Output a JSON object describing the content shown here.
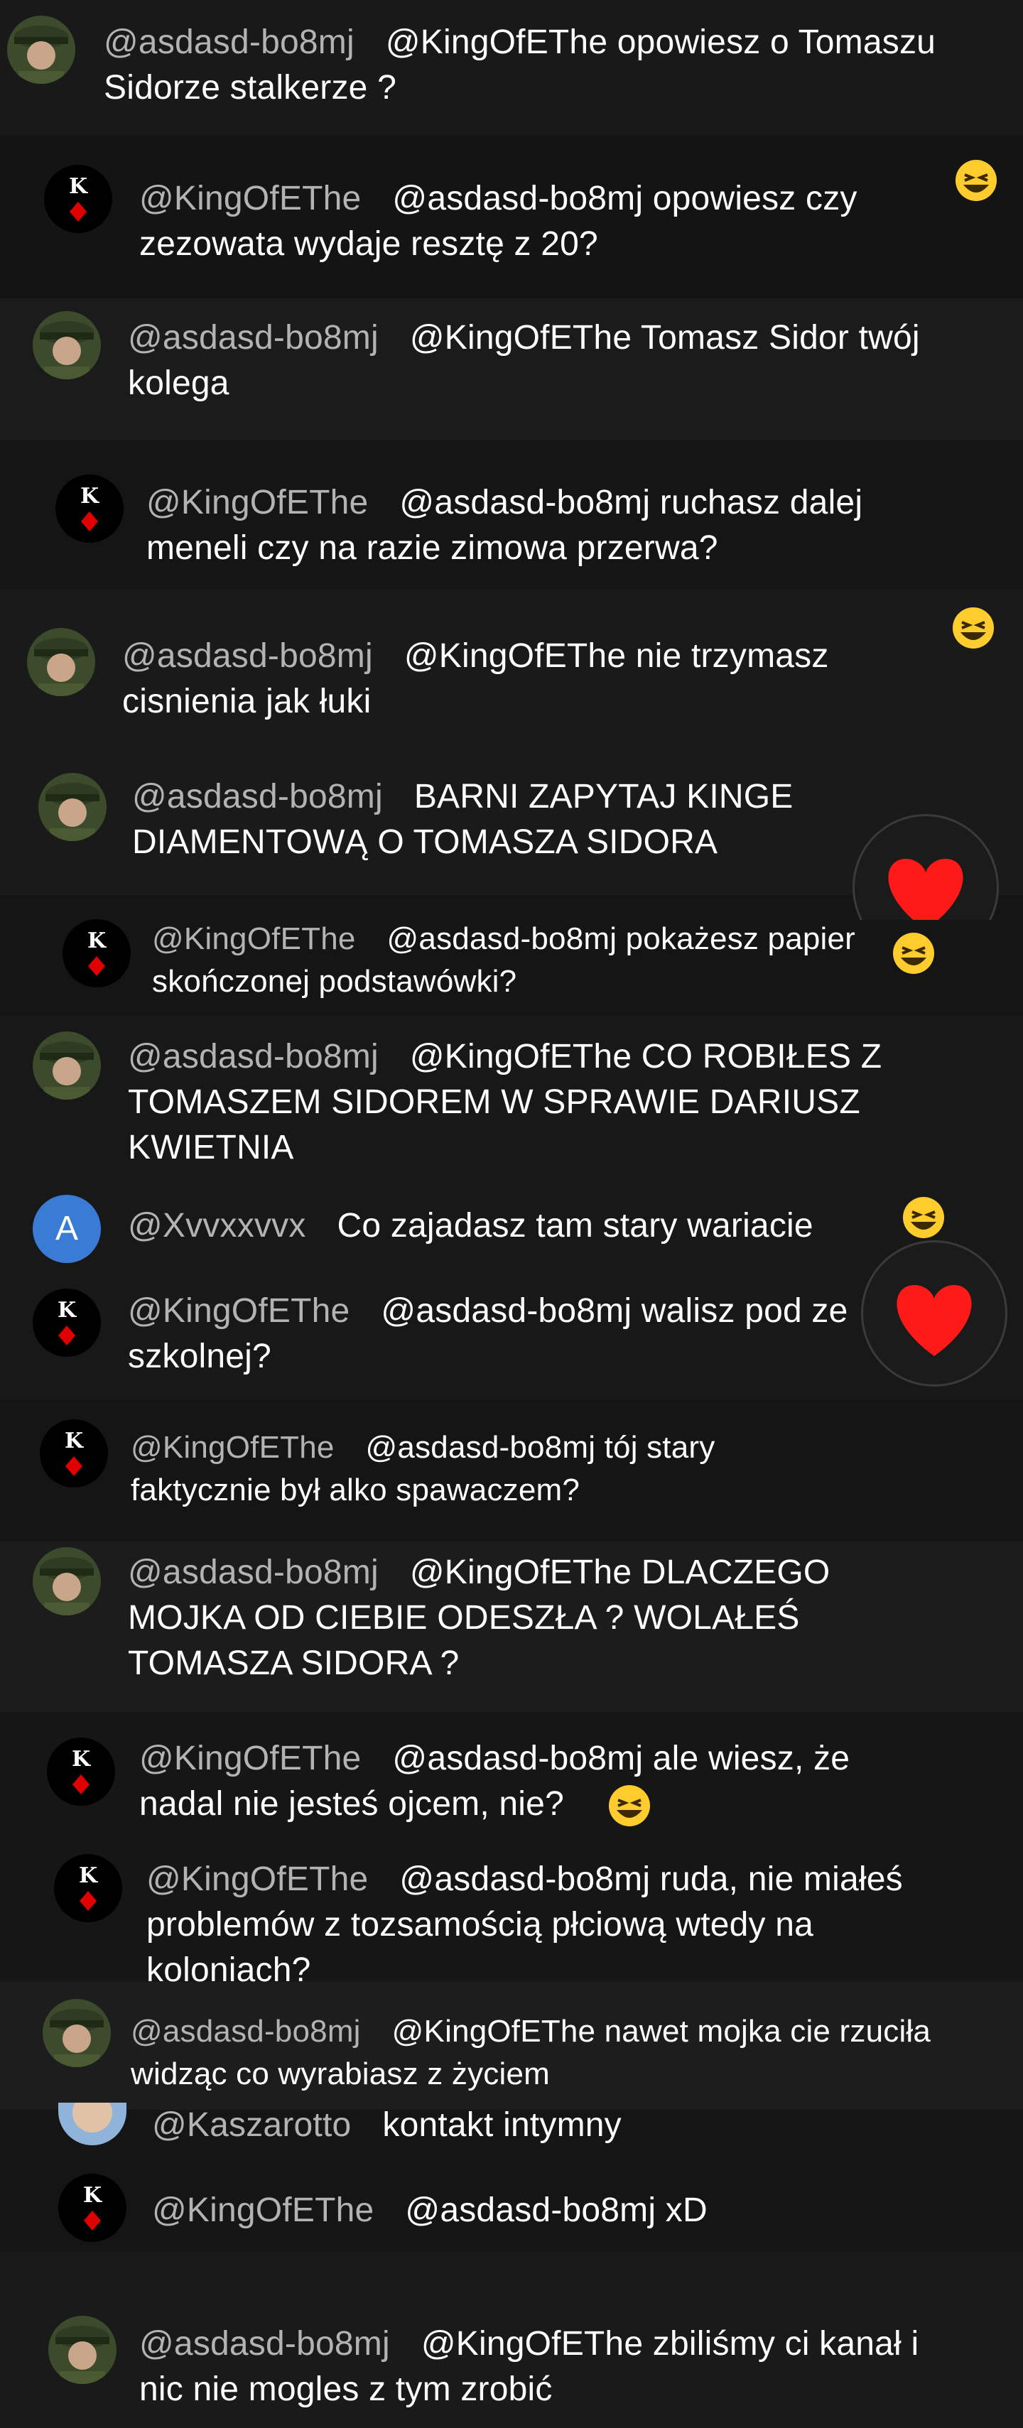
{
  "comments": [
    {
      "username": "@asdasd-bo8mj",
      "text": "@KingOfEThe opowiesz o Tomaszu Sidorze stalkerze ?",
      "avatar": "soldier-icon"
    },
    {
      "username": "@KingOfEThe",
      "text": "@asdasd-bo8mj opowiesz czy zezowata wydaje resztę z 20?",
      "avatar": "king-card-icon"
    },
    {
      "username": "@asdasd-bo8mj",
      "text": "@KingOfEThe Tomasz Sidor twój kolega",
      "avatar": "soldier-icon"
    },
    {
      "username": "@KingOfEThe",
      "text": "@asdasd-bo8mj ruchasz dalej meneli czy na razie zimowa przerwa?",
      "avatar": "king-card-icon"
    },
    {
      "username": "@asdasd-bo8mj",
      "text": "@KingOfEThe nie trzymasz cisnienia jak łuki",
      "avatar": "soldier-icon"
    },
    {
      "username": "@asdasd-bo8mj",
      "text": "BARNI ZAPYTAJ KINGE DIAMENTOWĄ O TOMASZA SIDORA",
      "avatar": "soldier-icon"
    },
    {
      "username": "@KingOfEThe",
      "text": "@asdasd-bo8mj pokażesz papier skończonej podstawówki?",
      "avatar": "king-card-icon"
    },
    {
      "username": "@asdasd-bo8mj",
      "text": "@KingOfEThe CO ROBIŁES Z TOMASZEM SIDOREM W SPRAWIE DARIUSZ KWIETNIA",
      "avatar": "soldier-icon"
    },
    {
      "username": "@Xvvxxvvx",
      "text": "Co zajadasz tam stary wariacie",
      "avatar": "letter-a-icon",
      "avatar_letter": "A"
    },
    {
      "username": "@KingOfEThe",
      "text": "@asdasd-bo8mj walisz pod ze szkolnej?",
      "avatar": "king-card-icon"
    },
    {
      "username": "@KingOfEThe",
      "text": "@asdasd-bo8mj tój stary faktycznie był alko spawaczem?",
      "avatar": "king-card-icon"
    },
    {
      "username": "@asdasd-bo8mj",
      "text": "@KingOfEThe DLACZEGO MOJKA OD CIEBIE ODESZŁA ? WOLAŁEŚ TOMASZA SIDORA ?",
      "avatar": "soldier-icon"
    },
    {
      "username": "@KingOfEThe",
      "text": "@asdasd-bo8mj ale wiesz, że nadal nie jesteś ojcem, nie?",
      "avatar": "king-card-icon"
    },
    {
      "username": "@KingOfEThe",
      "text": "@asdasd-bo8mj ruda, nie miałeś problemów z tozsamością płciową wtedy na koloniach?",
      "avatar": "king-card-icon"
    },
    {
      "username": "@asdasd-bo8mj",
      "text": "@KingOfEThe nawet mojka cie rzuciła widząc co wyrabiasz z życiem",
      "avatar": "soldier-icon"
    },
    {
      "username": "@Kaszarotto",
      "text": "kontakt intymny",
      "avatar": "face-icon"
    },
    {
      "username": "@KingOfEThe",
      "text": "@asdasd-bo8mj xD",
      "avatar": "king-card-icon"
    },
    {
      "username": "@asdasd-bo8mj",
      "text": "@KingOfEThe zbiliśmy ci kanał i nic nie mogles z tym zrobić",
      "avatar": "soldier-icon"
    }
  ],
  "reactions": [
    {
      "type": "grinning-squinting-emoji"
    },
    {
      "type": "heart"
    }
  ],
  "colors": {
    "background": "#161616",
    "username": "#b3b3b3",
    "text": "#ffffff",
    "avatar_blue": "#3a7bd5",
    "heart": "#ff1a1a"
  }
}
